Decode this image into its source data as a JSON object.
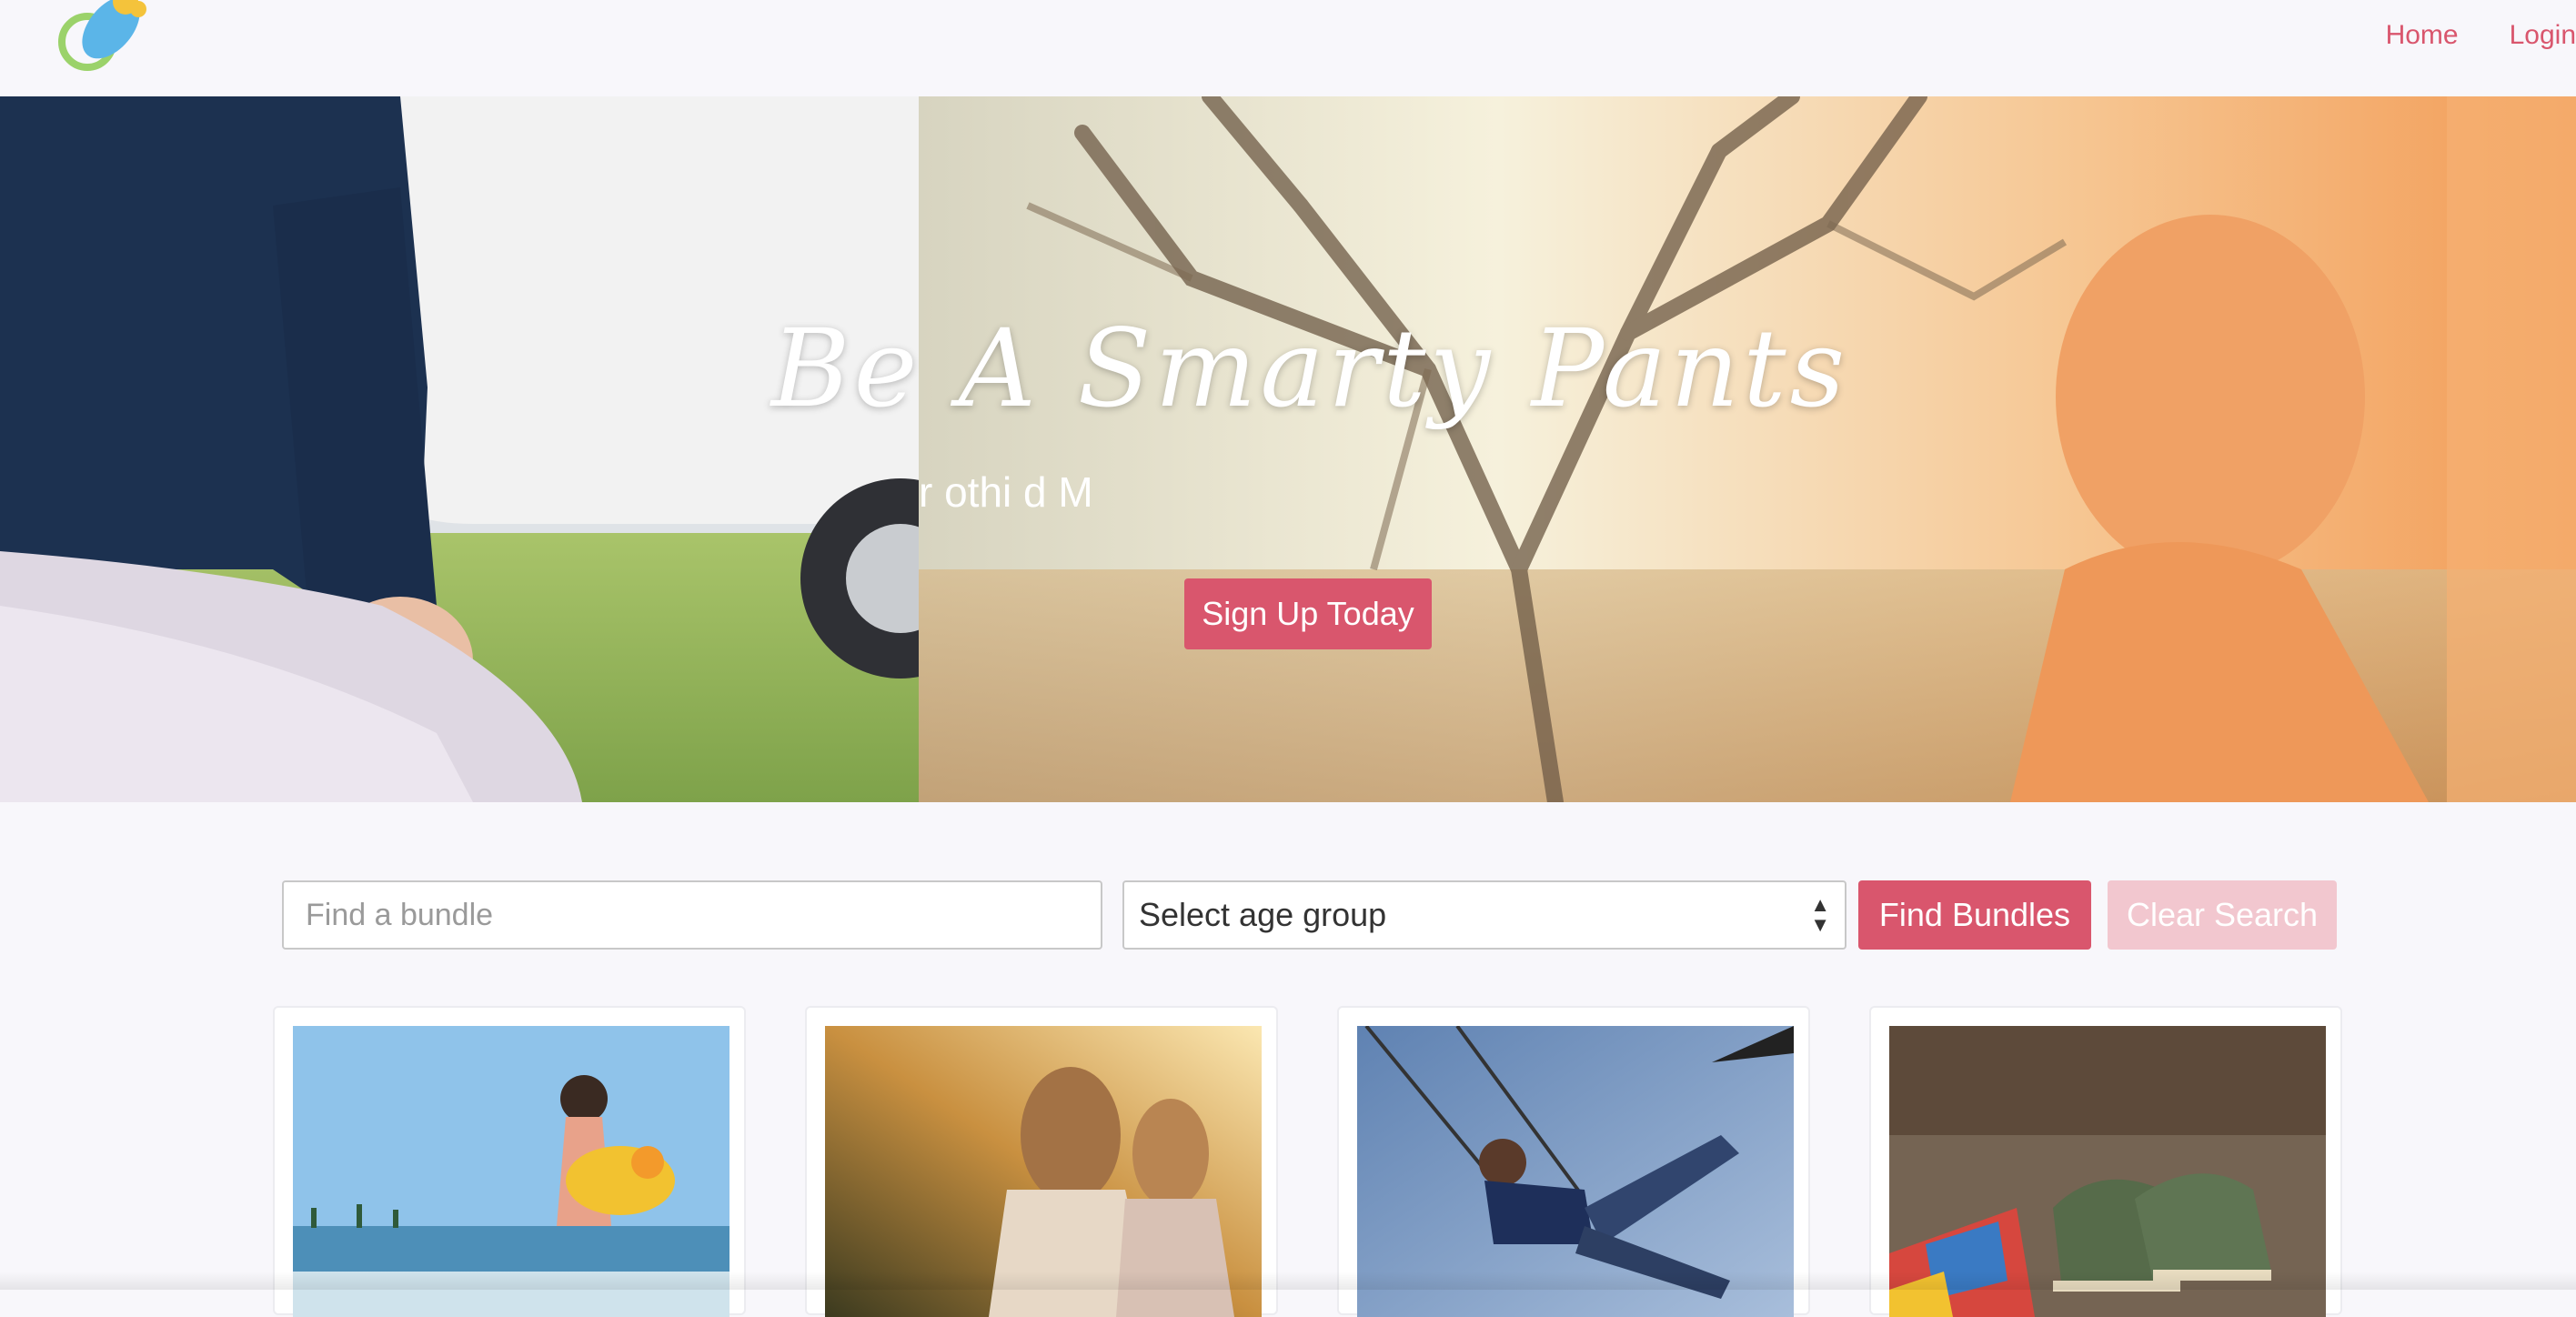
{
  "brand": {
    "logo_icon": "pacifier-logo-icon"
  },
  "nav": {
    "home": "Home",
    "login": "Login"
  },
  "hero": {
    "title": "Be A Smarty Pants",
    "subtitle": "r      othi     d M",
    "cta": "Sign Up Today"
  },
  "search": {
    "placeholder": "Find a bundle",
    "age_select_value": "Select age group",
    "find_label": "Find Bundles",
    "clear_label": "Clear Search"
  },
  "colors": {
    "accent": "#d9566d",
    "accent_disabled": "#f2c7cf",
    "background": "#f8f7fb"
  },
  "cards": [
    {
      "image": "girl-at-beach-with-duck-float-photo"
    },
    {
      "image": "two-girls-in-sunlit-field-photo"
    },
    {
      "image": "boy-on-swing-photo"
    },
    {
      "image": "baby-shoes-on-blanket-photo"
    }
  ]
}
